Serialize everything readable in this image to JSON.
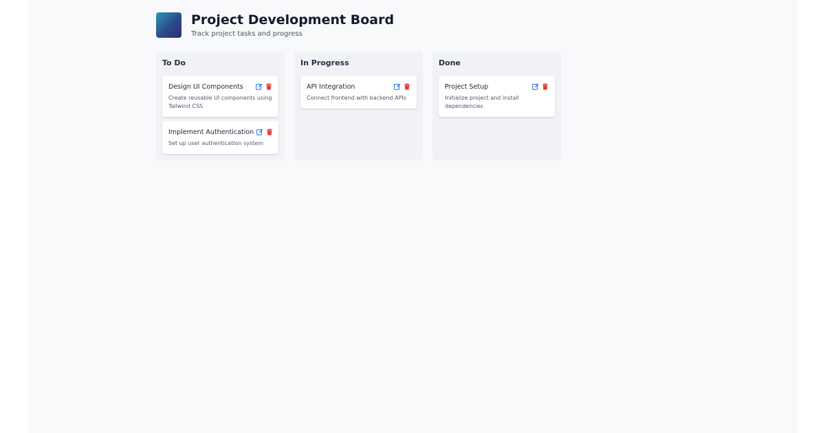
{
  "header": {
    "title": "Project Development Board",
    "subtitle": "Track project tasks and progress"
  },
  "colors": {
    "edit_icon": "#2f7fe0",
    "delete_icon": "#e23b3b"
  },
  "columns": [
    {
      "title": "To Do",
      "cards": [
        {
          "title": "Design UI Components",
          "description": "Create reusable UI components using Tailwind CSS",
          "edit_icon": "edit-icon",
          "delete_icon": "trash-icon"
        },
        {
          "title": "Implement Authentication",
          "description": "Set up user authentication system",
          "edit_icon": "edit-icon",
          "delete_icon": "trash-icon"
        }
      ]
    },
    {
      "title": "In Progress",
      "cards": [
        {
          "title": "API Integration",
          "description": "Connect frontend with backend APIs",
          "edit_icon": "edit-icon",
          "delete_icon": "trash-icon"
        }
      ]
    },
    {
      "title": "Done",
      "cards": [
        {
          "title": "Project Setup",
          "description": "Initialize project and install dependencies",
          "edit_icon": "edit-icon",
          "delete_icon": "trash-icon"
        }
      ]
    }
  ]
}
